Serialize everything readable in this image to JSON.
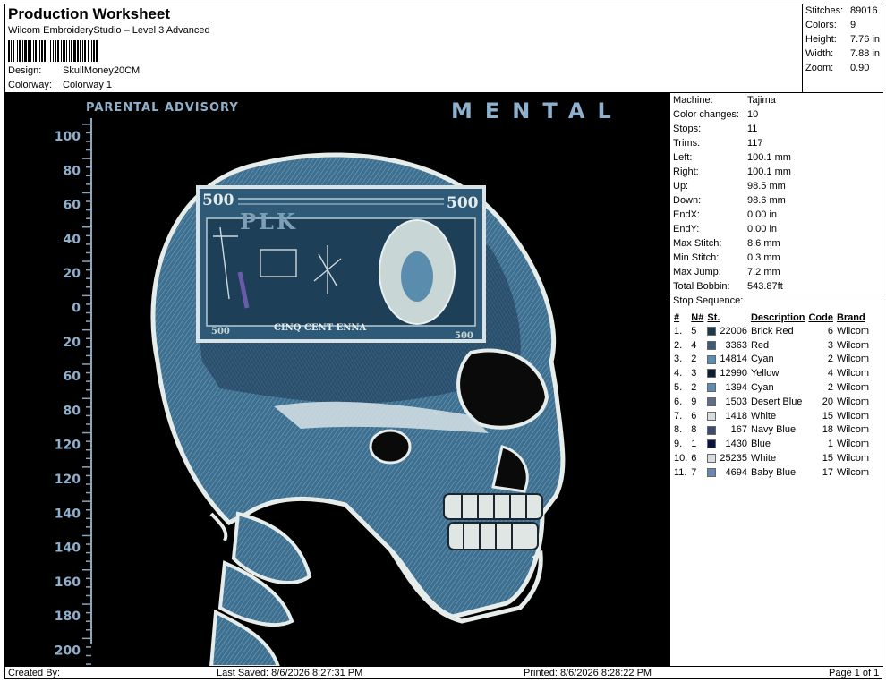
{
  "header": {
    "title": "Production Worksheet",
    "software": "Wilcom EmbroideryStudio – Level 3 Advanced",
    "design_label": "Design:",
    "design_value": "SkullMoney20CM",
    "colorway_label": "Colorway:",
    "colorway_value": "Colorway 1"
  },
  "stats": {
    "stitches_label": "Stitches:",
    "stitches": "89016",
    "colors_label": "Colors:",
    "colors": "9",
    "height_label": "Height:",
    "height": "7.76 in",
    "width_label": "Width:",
    "width": "7.88 in",
    "zoom_label": "Zoom:",
    "zoom": "0.90"
  },
  "machine": {
    "machine_label": "Machine:",
    "machine": "Tajima",
    "color_changes_label": "Color changes:",
    "color_changes": "10",
    "stops_label": "Stops:",
    "stops": "11",
    "trims_label": "Trims:",
    "trims": "117",
    "left_label": "Left:",
    "left": "100.1 mm",
    "right_label": "Right:",
    "right": "100.1 mm",
    "up_label": "Up:",
    "up": "98.5 mm",
    "down_label": "Down:",
    "down": "98.6 mm",
    "endx_label": "EndX:",
    "endx": "0.00 in",
    "endy_label": "EndY:",
    "endy": "0.00 in",
    "max_stitch_label": "Max Stitch:",
    "max_stitch": "8.6 mm",
    "min_stitch_label": "Min Stitch:",
    "min_stitch": "0.3 mm",
    "max_jump_label": "Max Jump:",
    "max_jump": "7.2 mm",
    "total_bobbin_label": "Total Bobbin:",
    "total_bobbin": "543.87ft"
  },
  "stop_sequence": {
    "title": "Stop Sequence:",
    "headers": [
      "#",
      "N#",
      "St.",
      "Description",
      "Code",
      "Brand"
    ],
    "rows": [
      {
        "n": "1.",
        "needle": "5",
        "color": "#1d3a4d",
        "st": "22006",
        "desc": "Brick Red",
        "code": "6",
        "brand": "Wilcom"
      },
      {
        "n": "2.",
        "needle": "4",
        "color": "#3b5a78",
        "st": "3363",
        "desc": "Red",
        "code": "3",
        "brand": "Wilcom"
      },
      {
        "n": "3.",
        "needle": "2",
        "color": "#5a8fb5",
        "st": "14814",
        "desc": "Cyan",
        "code": "2",
        "brand": "Wilcom"
      },
      {
        "n": "4.",
        "needle": "3",
        "color": "#0f1f33",
        "st": "12990",
        "desc": "Yellow",
        "code": "4",
        "brand": "Wilcom"
      },
      {
        "n": "5.",
        "needle": "2",
        "color": "#5a8fb5",
        "st": "1394",
        "desc": "Cyan",
        "code": "2",
        "brand": "Wilcom"
      },
      {
        "n": "6.",
        "needle": "9",
        "color": "#5f6f8a",
        "st": "1503",
        "desc": "Desert Blue",
        "code": "20",
        "brand": "Wilcom"
      },
      {
        "n": "7.",
        "needle": "6",
        "color": "#d8dde0",
        "st": "1418",
        "desc": "White",
        "code": "15",
        "brand": "Wilcom"
      },
      {
        "n": "8.",
        "needle": "8",
        "color": "#3e4d6e",
        "st": "167",
        "desc": "Navy Blue",
        "code": "18",
        "brand": "Wilcom"
      },
      {
        "n": "9.",
        "needle": "1",
        "color": "#0a1540",
        "st": "1430",
        "desc": "Blue",
        "code": "1",
        "brand": "Wilcom"
      },
      {
        "n": "10.",
        "needle": "6",
        "color": "#d8dde0",
        "st": "25235",
        "desc": "White",
        "code": "15",
        "brand": "Wilcom"
      },
      {
        "n": "11.",
        "needle": "7",
        "color": "#6a86b5",
        "st": "4694",
        "desc": "Baby Blue",
        "code": "17",
        "brand": "Wilcom"
      }
    ]
  },
  "artwork": {
    "parental_advisory": "PARENTAL ADVISORY",
    "mental": "MENTAL",
    "bill_value_left": "500",
    "bill_value_right": "500",
    "bill_text": "PLK",
    "bill_caption": "CINQ CENT ENNA",
    "bill_small_left": "500",
    "bill_small_right": "500",
    "ruler_labels": [
      "100",
      "80",
      "60",
      "40",
      "20",
      "0",
      "20",
      "60",
      "80",
      "120",
      "120",
      "140",
      "140",
      "160",
      "180",
      "200"
    ]
  },
  "footer": {
    "created_by": "Created By:",
    "last_saved": "Last Saved: 8/6/2026 8:27:31 PM",
    "printed": "Printed: 8/6/2026 8:28:22 PM",
    "page": "Page 1 of 1"
  }
}
